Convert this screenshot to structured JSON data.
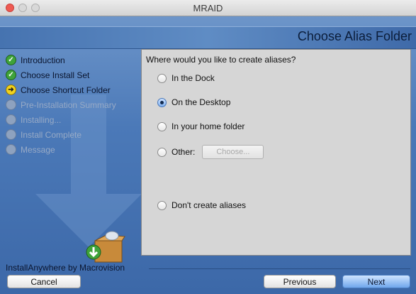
{
  "window": {
    "title": "MRAID"
  },
  "header": {
    "step_title": "Choose Alias Folder"
  },
  "steps": [
    {
      "label": "Introduction",
      "state": "done"
    },
    {
      "label": "Choose Install Set",
      "state": "done"
    },
    {
      "label": "Choose Shortcut Folder",
      "state": "current"
    },
    {
      "label": "Pre-Installation Summary",
      "state": "pending"
    },
    {
      "label": "Installing...",
      "state": "pending"
    },
    {
      "label": "Install Complete",
      "state": "pending"
    },
    {
      "label": "Message",
      "state": "pending"
    }
  ],
  "panel": {
    "question": "Where would you like to create aliases?",
    "options": [
      {
        "label": "In the Dock",
        "checked": false
      },
      {
        "label": "On the Desktop",
        "checked": true
      },
      {
        "label": "In your home folder",
        "checked": false
      },
      {
        "label": "Other:",
        "checked": false
      },
      {
        "label": "Don't create aliases",
        "checked": false
      }
    ],
    "choose_label": "Choose..."
  },
  "footer": {
    "brand": "InstallAnywhere by Macrovision",
    "cancel_label": "Cancel",
    "previous_label": "Previous",
    "next_label": "Next"
  },
  "colors": {
    "accent": "#3f6cab",
    "done_icon": "#3fa33a",
    "current_icon": "#f2d21c",
    "close_button": "#ee5a52"
  }
}
